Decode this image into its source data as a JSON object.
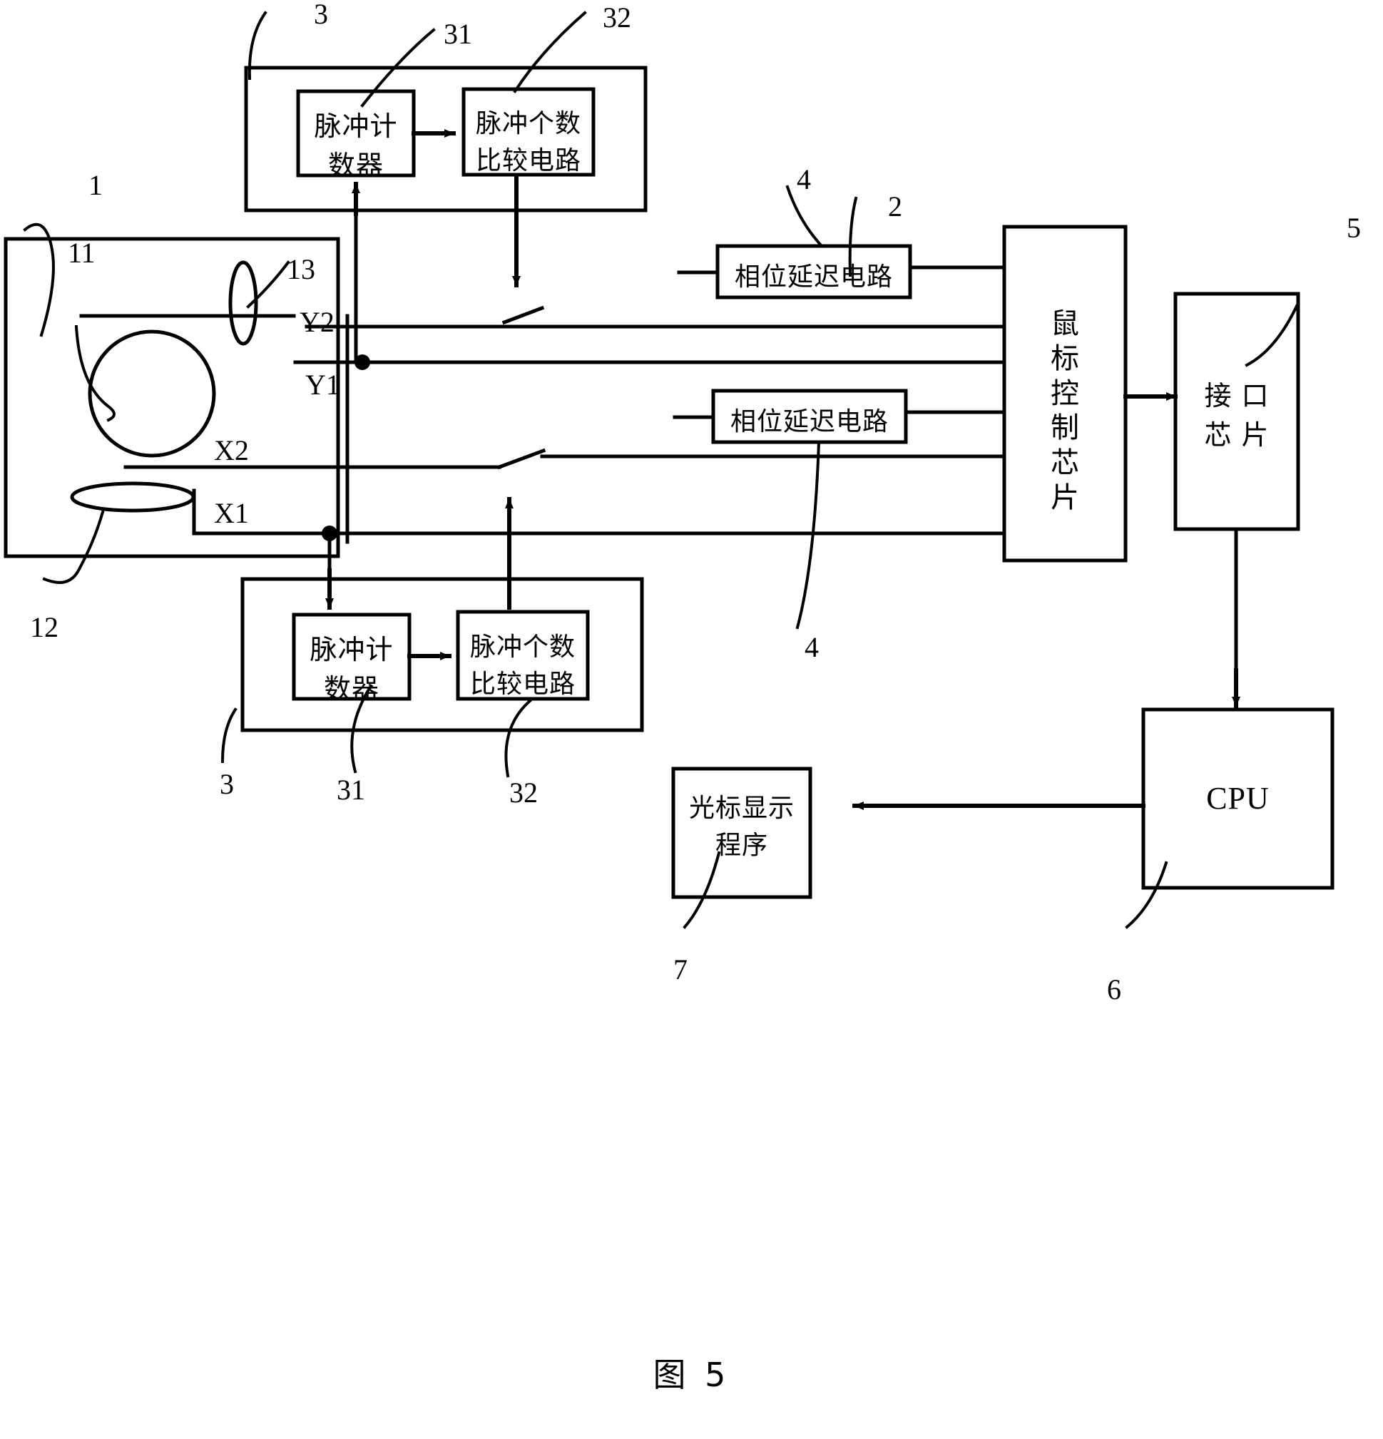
{
  "figure": {
    "caption": "图 5",
    "caption_number": "5"
  },
  "blocks": {
    "pulse_counter_top": {
      "line1": "脉冲计",
      "line2": "数器"
    },
    "pulse_compare_top": {
      "line1": "脉冲个数",
      "line2": "比较电路"
    },
    "pulse_counter_bottom": {
      "line1": "脉冲计",
      "line2": "数器"
    },
    "pulse_compare_bottom": {
      "line1": "脉冲个数",
      "line2": "比较电路"
    },
    "phase_delay_top": {
      "label": "相位延迟电路"
    },
    "phase_delay_bottom": {
      "label": "相位延迟电路"
    },
    "mouse_control_chip": {
      "chars": [
        "鼠",
        "标",
        "控",
        "制",
        "芯",
        "片"
      ]
    },
    "interface_chip": {
      "line1": "接 口",
      "line2": "芯 片"
    },
    "cpu": {
      "label": "CPU"
    },
    "cursor_display_program": {
      "line1": "光标显示",
      "line2": "程序"
    }
  },
  "signals": {
    "y2": "Y2",
    "y1": "Y1",
    "x2": "X2",
    "x1": "X1"
  },
  "numerals": {
    "mouse_body": "1",
    "ball": "11",
    "roller_x": "12",
    "roller_y": "13",
    "mouse_chip": "2",
    "counter_group_top": "3",
    "counter_top": "31",
    "compare_top": "32",
    "counter_group_bottom": "3",
    "counter_bottom": "31",
    "compare_bottom": "32",
    "phase_delay_top": "4",
    "phase_delay_bottom": "4",
    "interface_chip": "5",
    "cpu": "6",
    "cursor_program": "7"
  },
  "colors": {
    "ink": "#000000",
    "paper": "#ffffff"
  }
}
